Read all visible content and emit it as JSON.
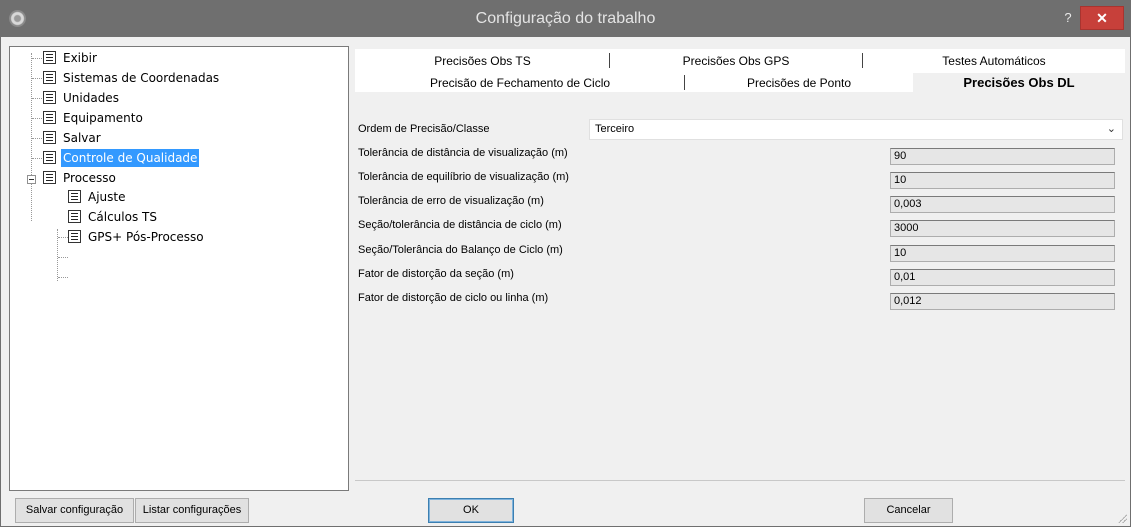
{
  "window": {
    "title": "Configuração do trabalho",
    "help_label": "?",
    "close_label": "✕"
  },
  "tree": {
    "items": [
      {
        "label": "Exibir",
        "selected": false
      },
      {
        "label": "Sistemas de Coordenadas",
        "selected": false
      },
      {
        "label": "Unidades",
        "selected": false
      },
      {
        "label": "Equipamento",
        "selected": false
      },
      {
        "label": "Salvar",
        "selected": false
      },
      {
        "label": "Controle de Qualidade",
        "selected": true
      },
      {
        "label": "Processo",
        "selected": false,
        "expanded": true
      },
      {
        "label": "Ajuste",
        "selected": false
      },
      {
        "label": "Cálculos TS",
        "selected": false
      },
      {
        "label": "GPS+ Pós-Processo",
        "selected": false
      }
    ]
  },
  "tabs": {
    "row1": [
      "Precisões Obs TS",
      "Precisões Obs GPS",
      "Testes Automáticos"
    ],
    "row2": [
      "Precisão de Fechamento de Ciclo",
      "Precisões de Ponto",
      "Precisões Obs DL"
    ],
    "active": "Precisões Obs DL"
  },
  "form": {
    "order_label": "Ordem de Precisão/Classe",
    "order_value": "Terceiro",
    "chevron": "⌄",
    "rows": [
      {
        "label": "Tolerância de distância de visualização (m)",
        "value": "90"
      },
      {
        "label": "Tolerância de equilíbrio de visualização (m)",
        "value": "10"
      },
      {
        "label": "Tolerância de erro de visualização (m)",
        "value": "0,003"
      },
      {
        "label": "Seção/tolerância de distância de ciclo (m)",
        "value": "3000"
      },
      {
        "label": "Seção/Tolerância do Balanço de Ciclo (m)",
        "value": "10"
      },
      {
        "label": "Fator de distorção da seção (m)",
        "value": "0,01"
      },
      {
        "label": "Fator de distorção de ciclo ou linha (m)",
        "value": "0,012"
      }
    ]
  },
  "buttons": {
    "save_config": "Salvar configuração",
    "list_configs": "Listar configurações",
    "ok": "OK",
    "cancel": "Cancelar"
  },
  "colors": {
    "titlebar": "#6f6f6f",
    "close": "#c7403a",
    "selection": "#3399ff"
  }
}
